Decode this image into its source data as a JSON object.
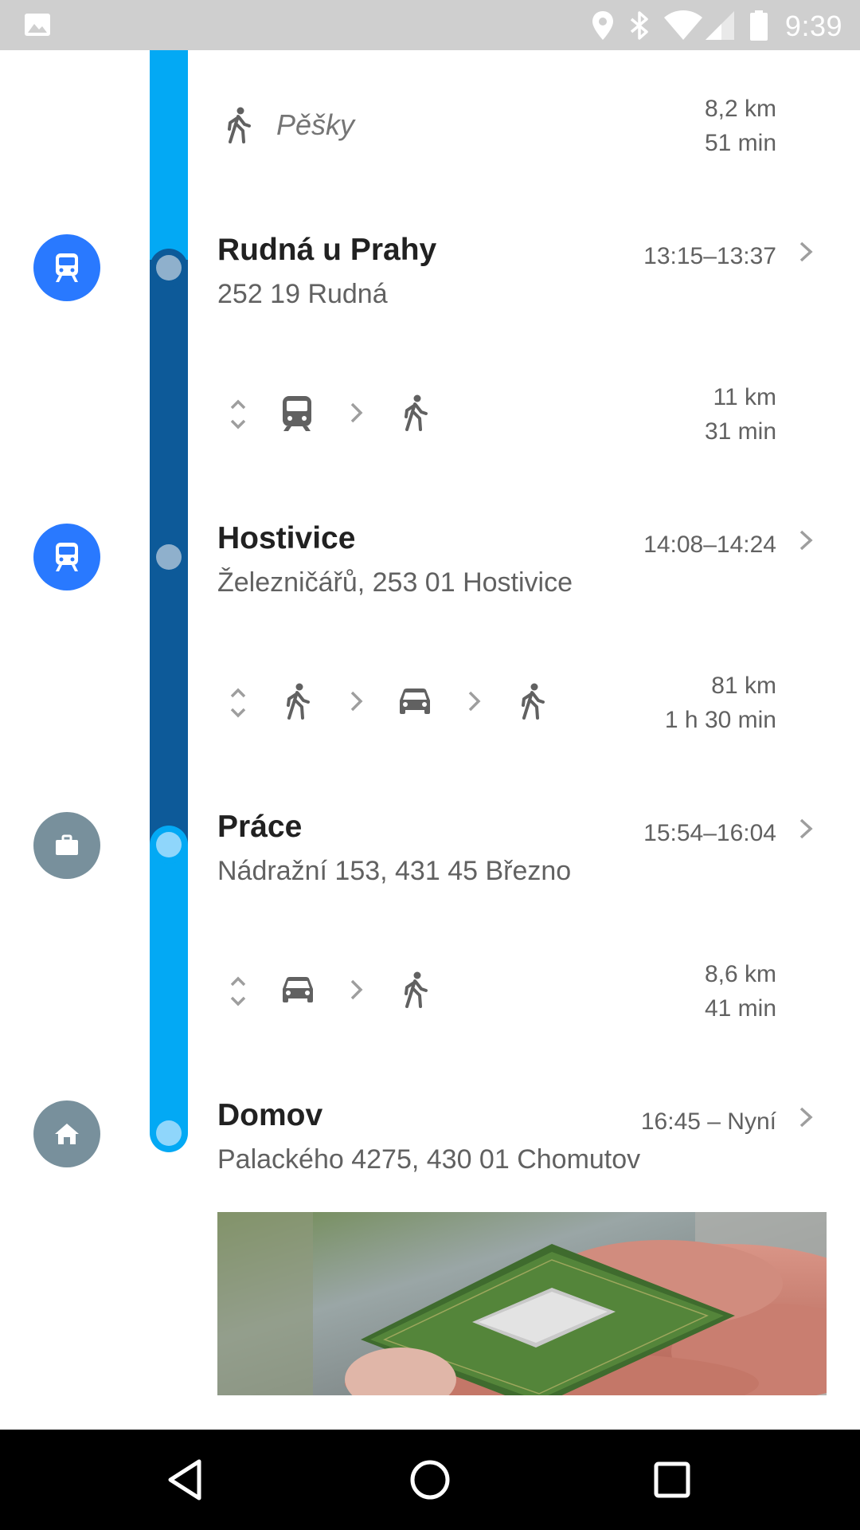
{
  "status_bar": {
    "time": "9:39",
    "icons": [
      "image-icon",
      "location-icon",
      "bluetooth-icon",
      "wifi-icon",
      "signal-icon",
      "battery-icon"
    ]
  },
  "segments": [
    {
      "mode_label": "Pěšky",
      "icons": [
        "walk-icon"
      ],
      "distance": "8,2 km",
      "duration": "51 min"
    },
    {
      "icons": [
        "expand-icon",
        "train-icon",
        "chevron-icon",
        "walk-icon"
      ],
      "distance": "11 km",
      "duration": "31 min"
    },
    {
      "icons": [
        "expand-icon",
        "walk-icon",
        "chevron-icon",
        "car-icon",
        "chevron-icon",
        "walk-icon"
      ],
      "distance": "81 km",
      "duration": "1 h 30 min"
    },
    {
      "icons": [
        "expand-icon",
        "car-icon",
        "chevron-icon",
        "walk-icon"
      ],
      "distance": "8,6 km",
      "duration": "41 min"
    }
  ],
  "places": [
    {
      "name": "Rudná u Prahy",
      "address": "252 19 Rudná",
      "time": "13:15–13:37",
      "icon": "train-icon"
    },
    {
      "name": "Hostivice",
      "address": "Železničářů, 253 01 Hostivice",
      "time": "14:08–14:24",
      "icon": "train-icon"
    },
    {
      "name": "Práce",
      "address": "Nádražní 153, 431 45 Březno",
      "time": "15:54–16:04",
      "icon": "briefcase-icon"
    },
    {
      "name": "Domov",
      "address": "Palackého 4275, 430 01 Chomutov",
      "time": "16:45 – Nyní",
      "icon": "home-icon"
    }
  ],
  "photo": {
    "icon": "cpu-photo"
  },
  "nav_bar": {
    "buttons": [
      "back-icon",
      "home-circle-icon",
      "recents-icon"
    ]
  },
  "colors": {
    "timeline_light": "#03a9f4",
    "timeline_dark": "#0d5a99",
    "train_circle": "#2979ff",
    "place_circle": "#78909c",
    "status_bar": "#cfcfcf"
  }
}
